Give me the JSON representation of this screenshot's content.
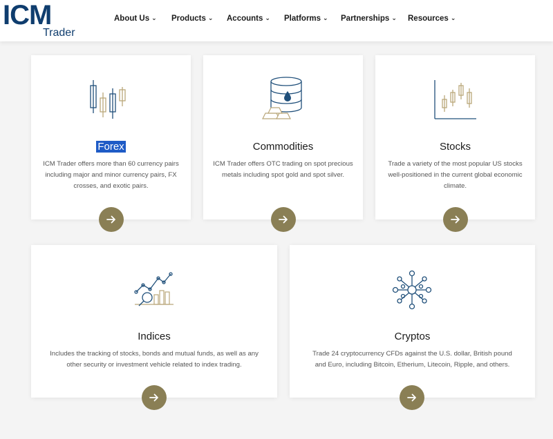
{
  "brand": {
    "name": "ICM",
    "sub": "Trader",
    "color": "#0f3d6e"
  },
  "nav": {
    "items": [
      {
        "label": "About Us"
      },
      {
        "label": "Products"
      },
      {
        "label": "Accounts"
      },
      {
        "label": "Platforms"
      },
      {
        "label": "Partnerships"
      },
      {
        "label": "Resources"
      }
    ]
  },
  "cards": [
    {
      "title": "Forex",
      "icon": "candlestick-icon",
      "description": "ICM Trader offers more than 60 currency pairs including major and minor currency pairs, FX crosses, and exotic pairs."
    },
    {
      "title": "Commodities",
      "icon": "oil-barrel-gold-icon",
      "description": "ICM Trader offers OTC trading on spot precious metals including spot gold and spot silver."
    },
    {
      "title": "Stocks",
      "icon": "stock-chart-icon",
      "description": "Trade a variety of the most popular US stocks well-positioned in the current global economic climate."
    },
    {
      "title": "Indices",
      "icon": "index-chart-magnifier-icon",
      "description": "Includes the tracking of stocks, bonds and mutual funds, as well as any other security or investment vehicle related to index trading."
    },
    {
      "title": "Cryptos",
      "icon": "crypto-network-icon",
      "description": "Trade 24 cryptocurrency CFDs against the U.S. dollar, British pound and Euro, including Bitcoin, Etherium, Litecoin, Ripple, and others."
    }
  ],
  "colors": {
    "accent": "#8a7f55",
    "highlight": "#1e5bc6",
    "icon_blue": "#1f4f7a",
    "icon_gold": "#b9a77a"
  }
}
